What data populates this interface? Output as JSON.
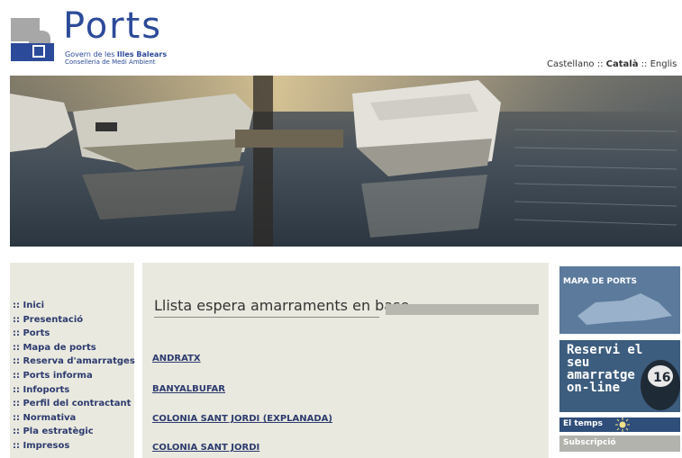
{
  "header": {
    "logo_title": "Ports",
    "logo_line1_prefix": "Govern de les ",
    "logo_line1_bold": "Illes Balears",
    "logo_line2": "Conselleria de Medi Ambient"
  },
  "languages": {
    "castellano": "Castellano",
    "separator": " :: ",
    "catala": "Català",
    "english": "Englis"
  },
  "nav": {
    "items": [
      ":: Inici",
      ":: Presentació",
      ":: Ports",
      ":: Mapa de ports",
      ":: Reserva d'amarratges",
      ":: Ports informa",
      ":: Infoports",
      ":: Perfil del contractant",
      ":: Normativa",
      ":: Pla estratègic",
      ":: Impresos"
    ]
  },
  "main": {
    "heading": "Llista espera amarraments en base",
    "ports": [
      "ANDRATX",
      "BANYALBUFAR",
      "COLONIA SANT JORDI (EXPLANADA)",
      "COLONIA SANT JORDI"
    ]
  },
  "right": {
    "mapa_label": "MAPA DE PORTS",
    "reservi_lines": [
      "Reservi el",
      "seu",
      "amarratge",
      "on-line"
    ],
    "temps_label": "El temps",
    "subscripcio_label": "Subscripció"
  },
  "colors": {
    "brand_blue": "#2c4a9a",
    "nav_text": "#2c3a6e",
    "panel_bg": "#e9e9df"
  }
}
